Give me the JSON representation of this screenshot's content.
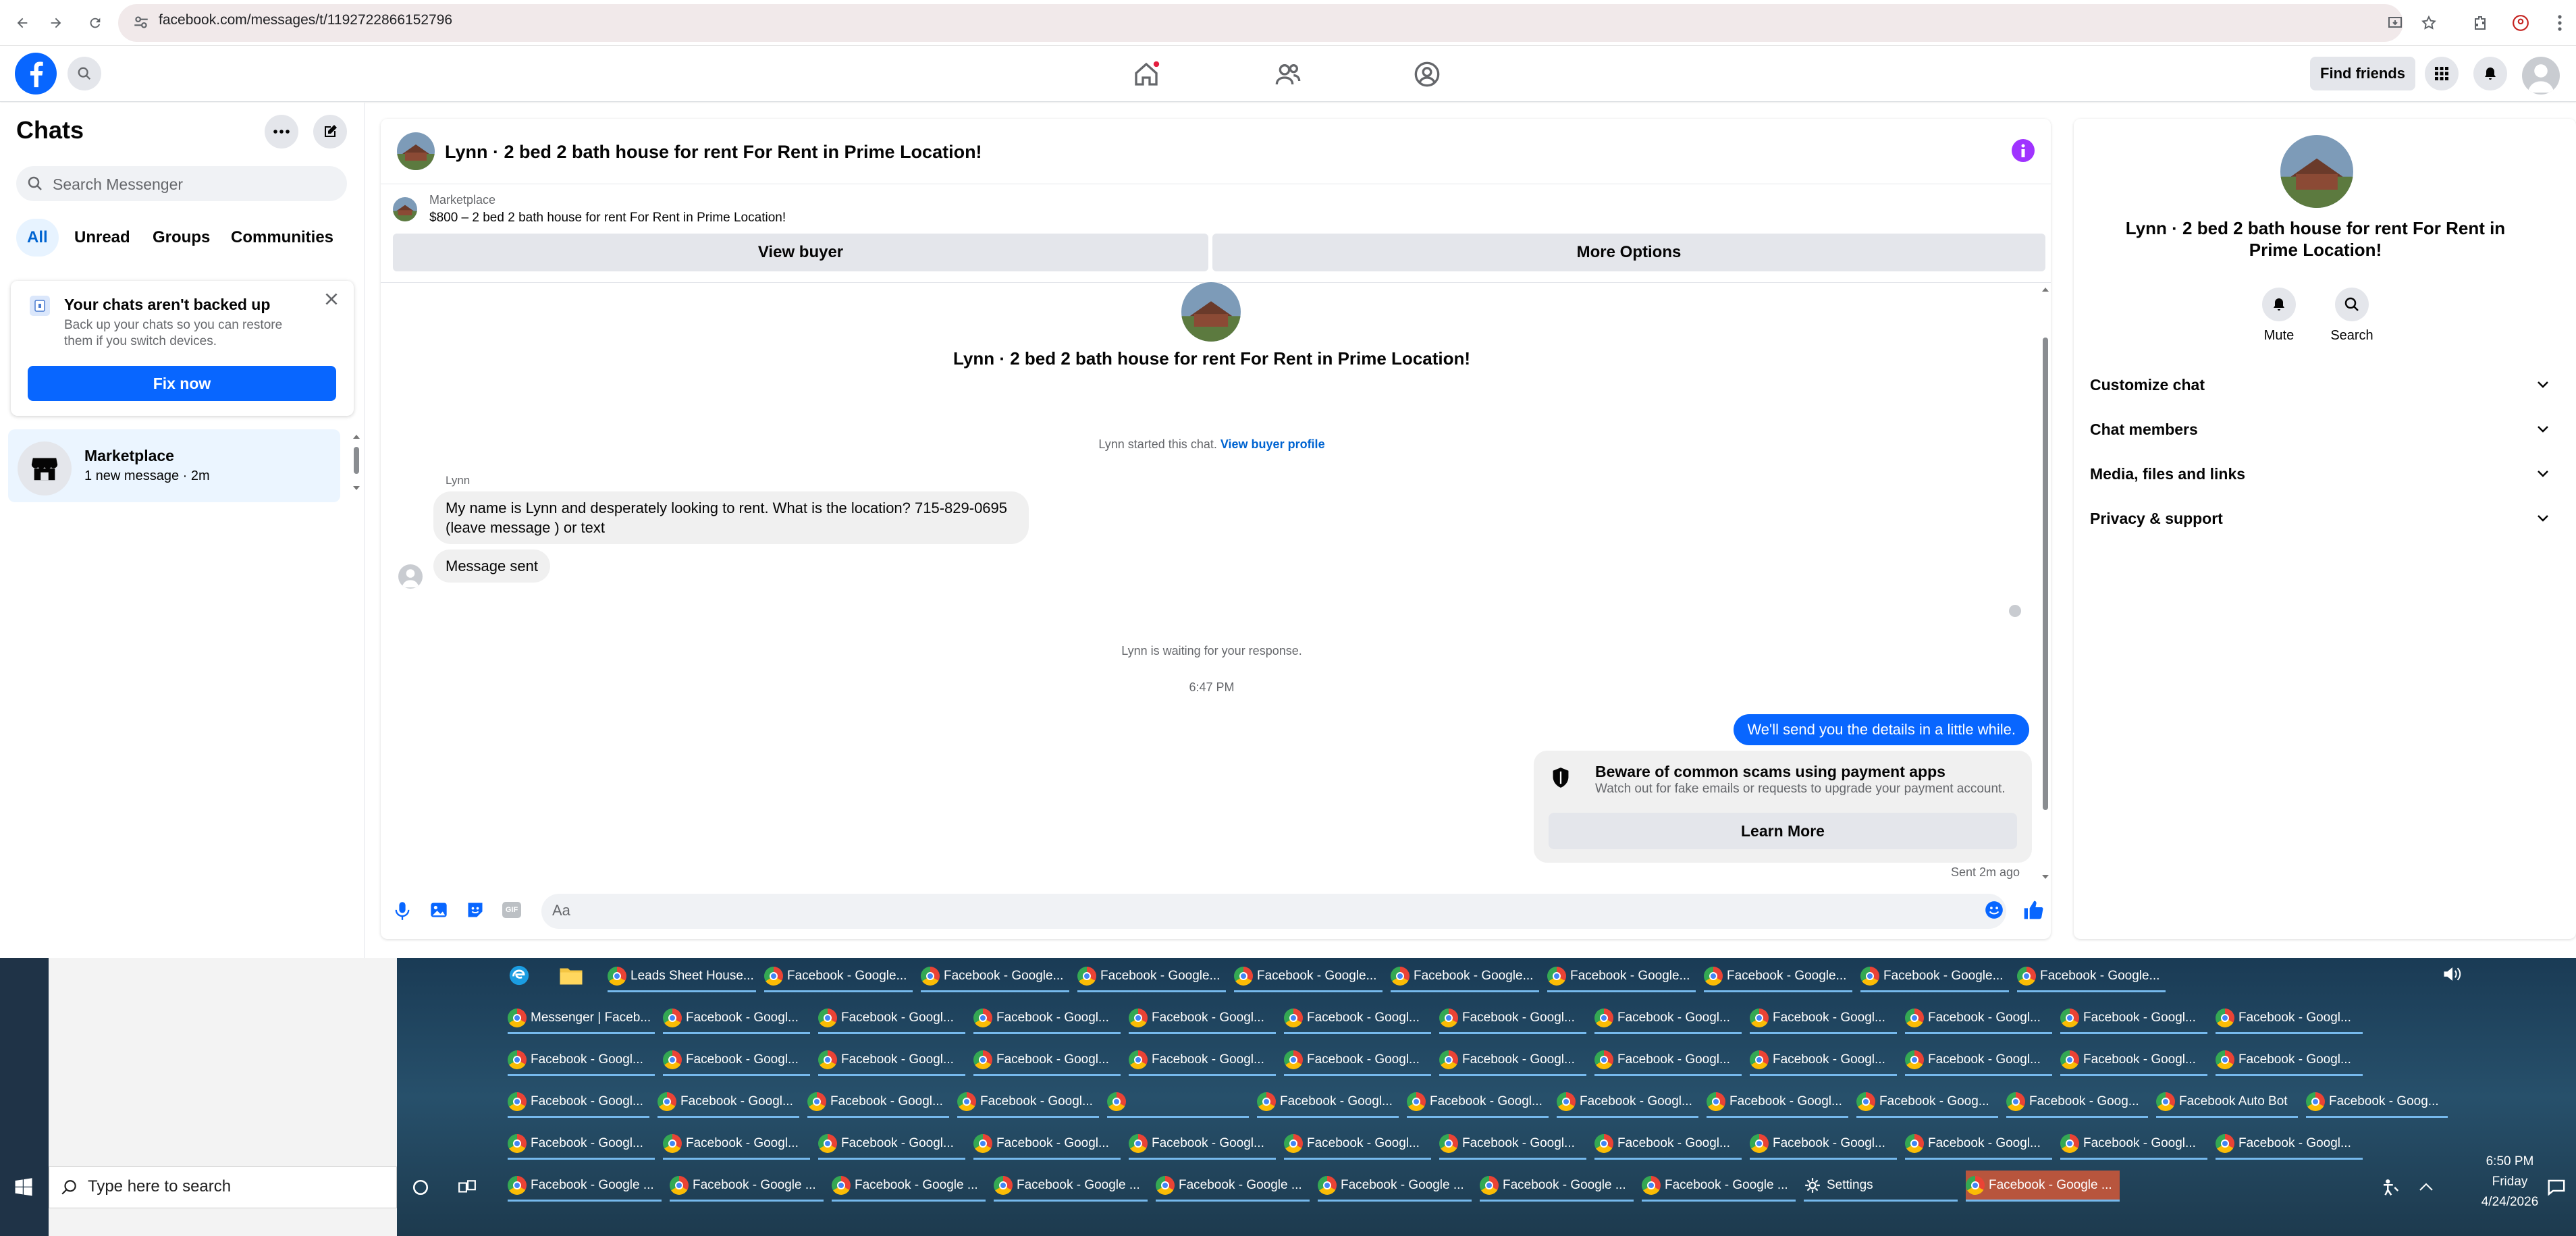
{
  "browser": {
    "url": "facebook.com/messages/t/1192722866152796"
  },
  "header": {
    "find_friends": "Find friends"
  },
  "sidebar": {
    "title": "Chats",
    "search_placeholder": "Search Messenger",
    "tabs": [
      "All",
      "Unread",
      "Groups",
      "Communities"
    ],
    "backup": {
      "title": "Your chats aren't backed up",
      "desc": "Back up your chats so you can restore them if you switch devices.",
      "button": "Fix now"
    },
    "conversation": {
      "name": "Marketplace",
      "sub": "1 new message · 2m"
    }
  },
  "chat": {
    "title": "Lynn · 2 bed 2 bath house for rent For Rent in Prime Location!",
    "marketplace_label": "Marketplace",
    "listing": "$800 – 2 bed 2 bath house for rent For Rent in Prime Location!",
    "view_buyer": "View buyer",
    "more_options": "More Options",
    "center_title": "Lynn · 2 bed 2 bath house for rent For Rent in Prime Location!",
    "started_text": "Lynn started this chat.",
    "view_profile": "View buyer profile",
    "sender_name": "Lynn",
    "msg1": "My name is Lynn and desperately looking to rent. What is the location? 715-829-0695 (leave message ) or text",
    "msg2": "Message sent",
    "waiting": "Lynn is waiting for your response.",
    "time": "6:47 PM",
    "out_msg": "We'll send you the details in a little while.",
    "scam_title": "Beware of common scams using payment apps",
    "scam_desc": "Watch out for fake emails or requests to upgrade your payment account.",
    "learn_more": "Learn More",
    "sent_ago": "Sent 2m ago",
    "compose_placeholder": "Aa",
    "gif_label": "GIF"
  },
  "right_panel": {
    "title": "Lynn · 2 bed 2 bath house for rent For Rent in Prime Location!",
    "mute": "Mute",
    "search": "Search",
    "items": [
      "Customize chat",
      "Chat members",
      "Media, files and links",
      "Privacy & support"
    ]
  },
  "taskbar": {
    "search_placeholder": "Type here to search",
    "row1": [
      "Leads Sheet House...",
      "Facebook - Google...",
      "Facebook - Google...",
      "Facebook - Google...",
      "Facebook - Google...",
      "Facebook - Google...",
      "Facebook - Google...",
      "Facebook - Google...",
      "Facebook - Google...",
      "Facebook - Google..."
    ],
    "row2": [
      "Messenger | Faceb...",
      "Facebook - Googl...",
      "Facebook - Googl...",
      "Facebook - Googl...",
      "Facebook - Googl...",
      "Facebook - Googl...",
      "Facebook - Googl...",
      "Facebook - Googl...",
      "Facebook - Googl...",
      "Facebook - Googl...",
      "Facebook - Googl...",
      "Facebook - Googl..."
    ],
    "row3": [
      "Facebook - Googl...",
      "Facebook - Googl...",
      "Facebook - Googl...",
      "Facebook - Googl...",
      "Facebook - Googl...",
      "Facebook - Googl...",
      "Facebook - Googl...",
      "Facebook - Googl...",
      "Facebook - Googl...",
      "Facebook - Googl...",
      "Facebook - Googl...",
      "Facebook - Googl..."
    ],
    "row4": [
      "Facebook - Googl...",
      "Facebook - Googl...",
      "Facebook - Googl...",
      "Facebook - Googl...",
      "",
      "Facebook - Googl...",
      "Facebook - Googl...",
      "Facebook - Googl...",
      "Facebook - Googl...",
      "Facebook - Goog...",
      "Facebook - Goog...",
      "Facebook Auto Bot",
      "Facebook - Goog..."
    ],
    "row5": [
      "Facebook - Googl...",
      "Facebook - Googl...",
      "Facebook - Googl...",
      "Facebook - Googl...",
      "Facebook - Googl...",
      "Facebook - Googl...",
      "Facebook - Googl...",
      "Facebook - Googl...",
      "Facebook - Googl...",
      "Facebook - Googl...",
      "Facebook - Googl...",
      "Facebook - Googl..."
    ],
    "row6": [
      "Facebook - Google ...",
      "Facebook - Google ...",
      "Facebook - Google ...",
      "Facebook - Google ...",
      "Facebook - Google ...",
      "Facebook - Google ...",
      "Facebook - Google ...",
      "Facebook - Google ...",
      "Settings",
      "Facebook - Google ..."
    ],
    "clock_time": "6:50 PM",
    "clock_day": "Friday",
    "clock_date": "4/24/2026"
  },
  "colors": {
    "fb_blue": "#0866ff",
    "accent_purple": "#a033ff"
  }
}
